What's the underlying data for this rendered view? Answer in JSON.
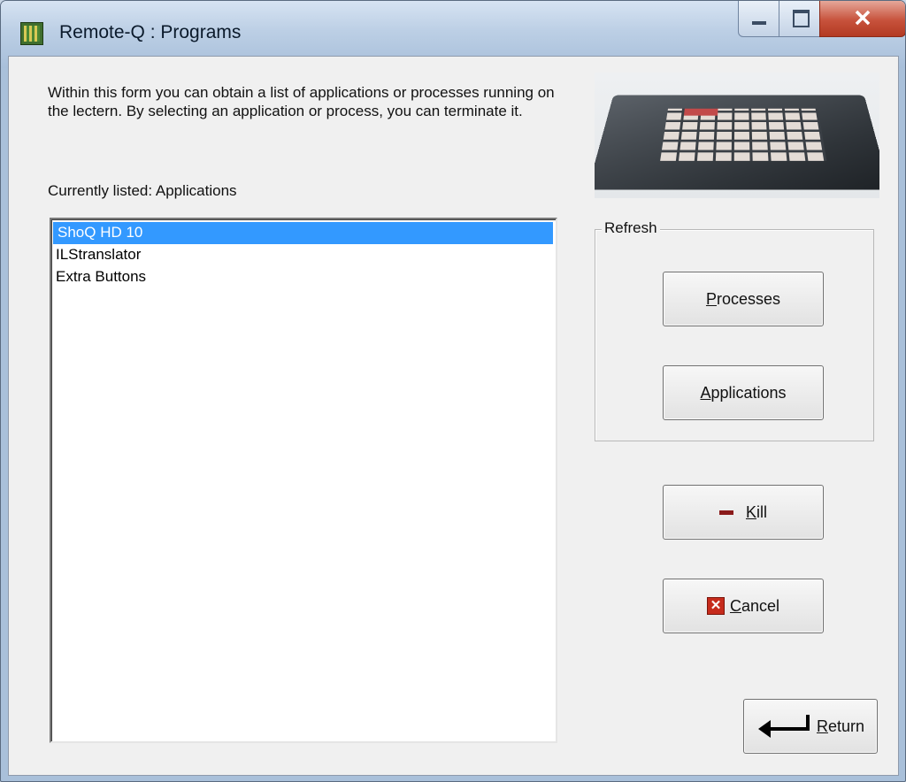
{
  "window": {
    "title": "Remote-Q : Programs",
    "controls": {
      "minimize": "",
      "maximize": "",
      "close": "✕"
    }
  },
  "form": {
    "description": "Within this form you can obtain a list of applications or processes running on the lectern. By selecting an application or process, you can terminate it.",
    "currently_listed": "Currently listed: Applications"
  },
  "list": {
    "items": [
      {
        "label": "ShoQ HD 10",
        "selected": true
      },
      {
        "label": "ILStranslator",
        "selected": false
      },
      {
        "label": "Extra Buttons",
        "selected": false
      }
    ]
  },
  "refresh_group": {
    "label": "Refresh",
    "processes_prefix": "P",
    "processes_rest": "rocesses",
    "applications_prefix": "A",
    "applications_rest": "pplications"
  },
  "actions": {
    "kill_prefix": "K",
    "kill_rest": "ill",
    "cancel_prefix": "C",
    "cancel_rest": "ancel",
    "return_prefix": "R",
    "return_rest": "eturn"
  },
  "icons": {
    "app": "lectern-app-icon",
    "kill": "minus-icon",
    "cancel": "red-x-icon",
    "return": "return-arrow-icon"
  },
  "colors": {
    "selection": "#3399ff",
    "close_button": "#c7523c"
  }
}
